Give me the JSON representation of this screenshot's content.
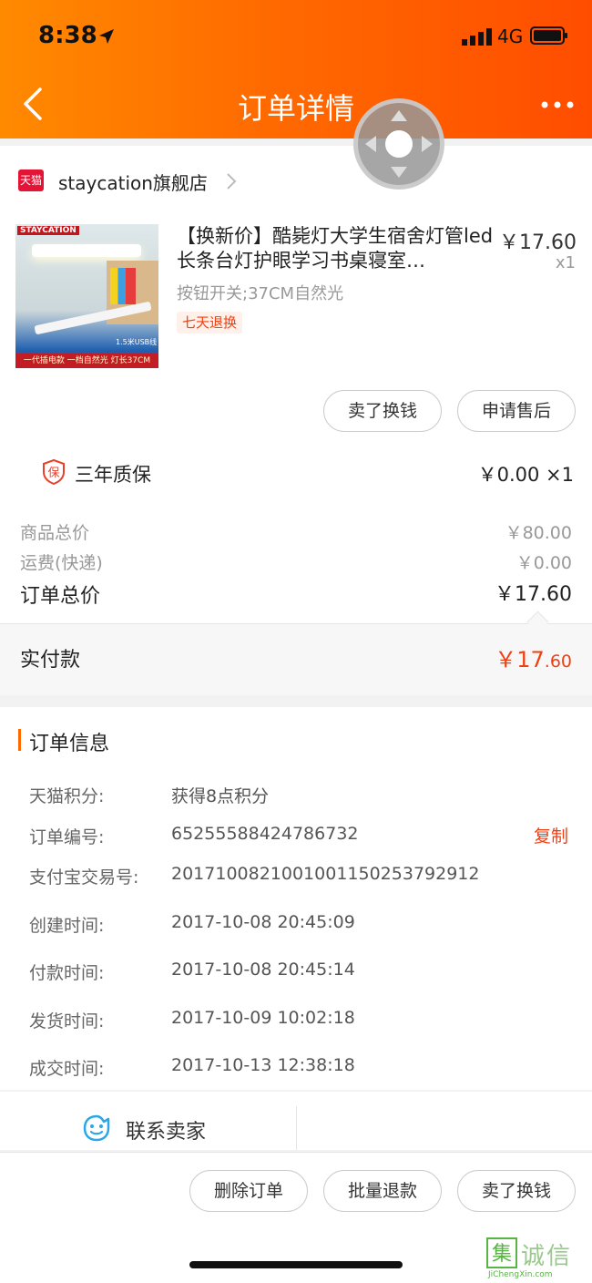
{
  "status_bar": {
    "time": "8:38",
    "network": "4G"
  },
  "nav": {
    "title": "订单详情"
  },
  "shop": {
    "logo_text": "天猫",
    "name": "staycation旗舰店"
  },
  "product": {
    "image_brand": "STAYCATION",
    "image_cable_label": "1.5米USB线",
    "image_bottom_text": "一代插电款 一档自然光 灯长37CM",
    "title": "【换新价】酷毙灯大学生宿舍灯管led长条台灯护眼学习书桌寝室…",
    "spec": "按钮开关;37CM自然光",
    "badge": "七天退换",
    "price": "￥17.60",
    "qty": "x1"
  },
  "item_actions": {
    "sell": "卖了换钱",
    "aftersale": "申请售后"
  },
  "warranty": {
    "icon_text": "保",
    "label": "三年质保",
    "price": "￥0.00 ×1"
  },
  "summary": {
    "goods_label": "商品总价",
    "goods_value": "￥80.00",
    "shipping_label": "运费(快递)",
    "shipping_value": "￥0.00",
    "total_label": "订单总价",
    "total_value": "￥17.60",
    "paid_label": "实付款",
    "paid_main": "￥17",
    "paid_decimal": ".60"
  },
  "order_info": {
    "title": "订单信息",
    "rows": [
      {
        "label": "天猫积分:",
        "value": "获得8点积分"
      },
      {
        "label": "订单编号:",
        "value": "65255588424786732"
      },
      {
        "label": "支付宝交易号:",
        "value": "2017100821001001150253792912"
      },
      {
        "label": "创建时间:",
        "value": "2017-10-08 20:45:09"
      },
      {
        "label": "付款时间:",
        "value": "2017-10-08 20:45:14"
      },
      {
        "label": "发货时间:",
        "value": "2017-10-09 10:02:18"
      },
      {
        "label": "成交时间:",
        "value": "2017-10-13 12:38:18"
      }
    ],
    "copy_label": "复制"
  },
  "contact": {
    "label": "联系卖家"
  },
  "bottom_actions": {
    "delete": "删除订单",
    "batch_refund": "批量退款",
    "sell": "卖了换钱"
  },
  "watermark": {
    "box_char": "集",
    "text": "诚信",
    "url": "JiChengXin.com"
  },
  "colors": {
    "accent": "#ff6a00",
    "price_red": "#f23f12",
    "tmall_red": "#e31436"
  }
}
